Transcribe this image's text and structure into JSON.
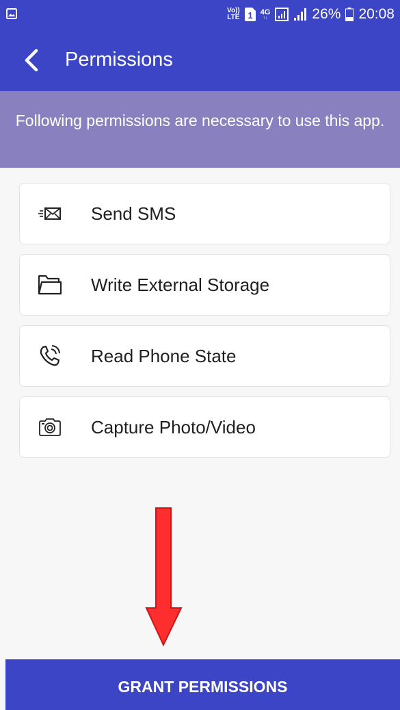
{
  "status_bar": {
    "volte_top": "Vo))",
    "volte_bottom": "LTE",
    "sim_slot": "1",
    "network_type": "4G",
    "battery_percent": "26%",
    "time": "20:08"
  },
  "app_bar": {
    "title": "Permissions"
  },
  "banner": {
    "message": "Following permissions are necessary to use this app."
  },
  "permissions": [
    {
      "label": "Send SMS",
      "icon": "sms-envelope-icon"
    },
    {
      "label": "Write External Storage",
      "icon": "folder-icon"
    },
    {
      "label": "Read Phone State",
      "icon": "phone-ringing-icon"
    },
    {
      "label": "Capture Photo/Video",
      "icon": "camera-icon"
    }
  ],
  "grant_button": {
    "label": "GRANT PERMISSIONS"
  },
  "colors": {
    "primary": "#3b45c6",
    "banner": "#8880bf",
    "arrow": "#ff2e2e"
  }
}
